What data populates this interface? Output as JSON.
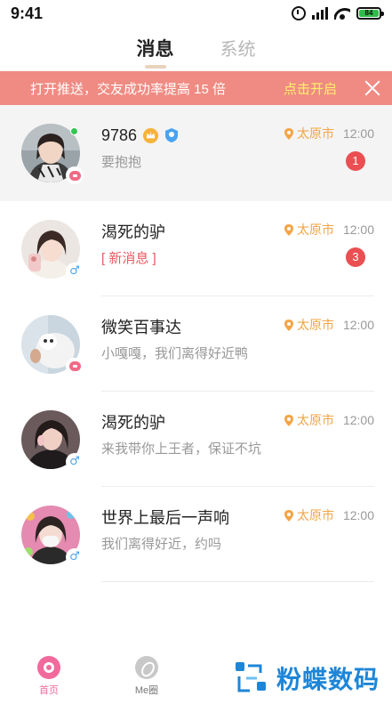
{
  "status_bar": {
    "time": "9:41",
    "battery": "84"
  },
  "tabs": [
    {
      "label": "消息",
      "active": true
    },
    {
      "label": "系统",
      "active": false
    }
  ],
  "banner": {
    "message": "打开推送，交友成功率提高 15 倍",
    "action": "点击开启"
  },
  "conversations": [
    {
      "name": "9786",
      "preview": "要抱抱",
      "location": "太原市",
      "time": "12:00",
      "unread": "1",
      "gender": "female",
      "online": true,
      "vip": true,
      "verified": true,
      "new_message": false
    },
    {
      "name": "渴死的驴",
      "preview": "[ 新消息 ]",
      "location": "太原市",
      "time": "12:00",
      "unread": "3",
      "gender": "male",
      "online": false,
      "new_message": true
    },
    {
      "name": "微笑百事达",
      "preview": "小嘎嘎，我们离得好近鸭",
      "location": "太原市",
      "time": "12:00",
      "unread": "",
      "gender": "female",
      "online": false,
      "new_message": false
    },
    {
      "name": "渴死的驴",
      "preview": "来我带你上王者，保证不坑",
      "location": "太原市",
      "time": "12:00",
      "unread": "",
      "gender": "male",
      "online": false,
      "new_message": false
    },
    {
      "name": "世界上最后一声响",
      "preview": "我们离得好近，约吗",
      "location": "太原市",
      "time": "12:00",
      "unread": "",
      "gender": "male",
      "online": false,
      "new_message": false
    }
  ],
  "bottom_nav": [
    {
      "label": "首页",
      "active": true,
      "icon": "home-icon"
    },
    {
      "label": "Me圈",
      "active": false,
      "icon": "me-circle-icon"
    }
  ],
  "watermark": {
    "text": "粉蝶数码"
  },
  "colors": {
    "accent": "#ef8b82",
    "location": "#f3a546",
    "badge": "#ea4f51",
    "brand_watermark": "#1d86d8",
    "home_active": "#f06a9c"
  }
}
